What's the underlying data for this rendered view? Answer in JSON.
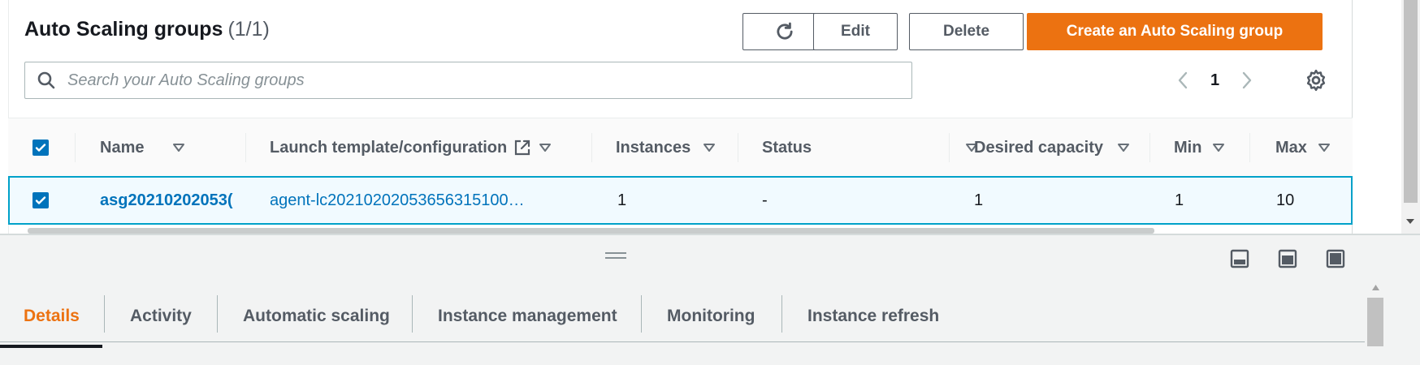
{
  "header": {
    "title": "Auto Scaling groups",
    "count": "(1/1)"
  },
  "actions": {
    "edit_label": "Edit",
    "delete_label": "Delete",
    "create_label": "Create an Auto Scaling group"
  },
  "search": {
    "placeholder": "Search your Auto Scaling groups"
  },
  "pagination": {
    "current_page": "1"
  },
  "table": {
    "columns": [
      "Name",
      "Launch template/configuration",
      "Instances",
      "Status",
      "Desired capacity",
      "Min",
      "Max"
    ],
    "rows": [
      {
        "name": "asg20210202053(",
        "launch_config": "agent-lc20210202053656315100…",
        "instances": "1",
        "status": "-",
        "desired_capacity": "1",
        "min": "1",
        "max": "10"
      }
    ]
  },
  "bottom_tabs": [
    {
      "label": "Details",
      "active": true
    },
    {
      "label": "Activity",
      "active": false
    },
    {
      "label": "Automatic scaling",
      "active": false
    },
    {
      "label": "Instance management",
      "active": false
    },
    {
      "label": "Monitoring",
      "active": false
    },
    {
      "label": "Instance refresh",
      "active": false
    }
  ],
  "colors": {
    "accent_orange": "#ec7211",
    "link_blue": "#0073bb",
    "selected_row_bg": "#f1faff",
    "selected_row_border": "#00a1c9"
  },
  "icons": [
    "refresh-icon",
    "search-icon",
    "chevron-left-icon",
    "chevron-right-icon",
    "gear-icon",
    "caret-down-icon",
    "external-link-icon",
    "checkbox-checked-icon",
    "drag-handle-icon",
    "panel-bottom-icon",
    "panel-side-icon",
    "panel-full-icon"
  ]
}
